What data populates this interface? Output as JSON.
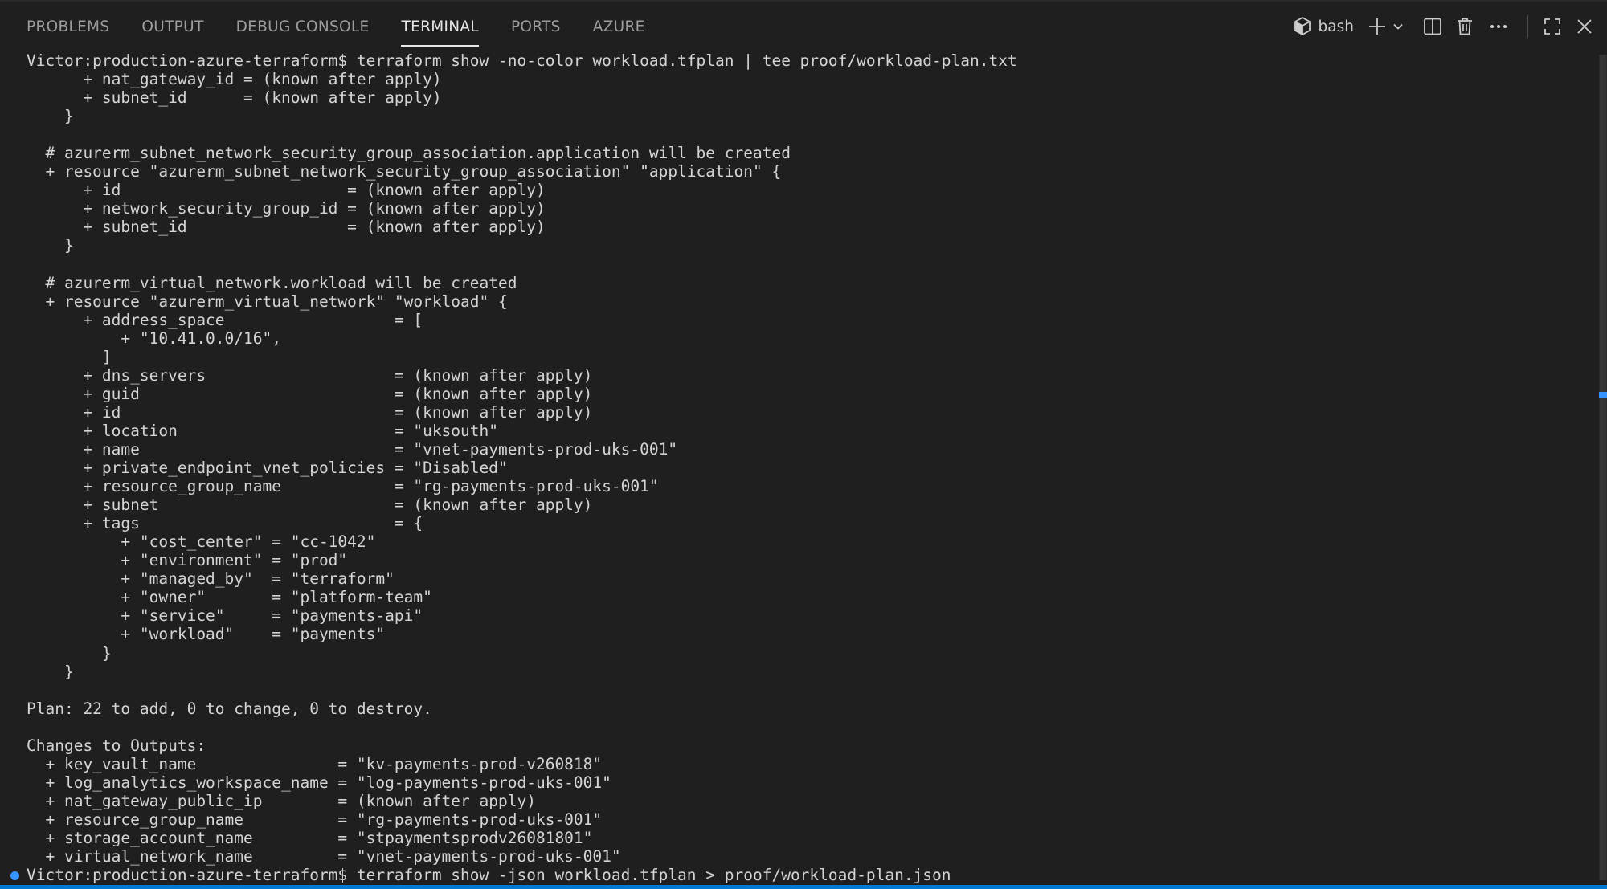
{
  "panel": {
    "tabs": [
      {
        "label": "PROBLEMS",
        "active": false
      },
      {
        "label": "OUTPUT",
        "active": false
      },
      {
        "label": "DEBUG CONSOLE",
        "active": false
      },
      {
        "label": "TERMINAL",
        "active": true
      },
      {
        "label": "PORTS",
        "active": false
      },
      {
        "label": "AZURE",
        "active": false
      }
    ],
    "toolbar": {
      "shell_icon": "terminal-cube-icon",
      "shell_name": "bash",
      "new_terminal_icon": "plus-icon",
      "dropdown_icon": "chevron-down-icon",
      "split_icon": "split-terminal-icon",
      "kill_icon": "trash-icon",
      "more_icon": "ellipsis-icon",
      "maximize_icon": "maximize-icon",
      "close_icon": "close-icon"
    }
  },
  "colors": {
    "background": "#1f1f1f",
    "text": "#d4d4d4",
    "accent": "#0078d4",
    "command_marker": "#3794ff"
  },
  "terminal": {
    "lines": [
      "Victor:production-azure-terraform$ terraform show -no-color workload.tfplan | tee proof/workload-plan.txt",
      "      + nat_gateway_id = (known after apply)",
      "      + subnet_id      = (known after apply)",
      "    }",
      "",
      "  # azurerm_subnet_network_security_group_association.application will be created",
      "  + resource \"azurerm_subnet_network_security_group_association\" \"application\" {",
      "      + id                        = (known after apply)",
      "      + network_security_group_id = (known after apply)",
      "      + subnet_id                 = (known after apply)",
      "    }",
      "",
      "  # azurerm_virtual_network.workload will be created",
      "  + resource \"azurerm_virtual_network\" \"workload\" {",
      "      + address_space                  = [",
      "          + \"10.41.0.0/16\",",
      "        ]",
      "      + dns_servers                    = (known after apply)",
      "      + guid                           = (known after apply)",
      "      + id                             = (known after apply)",
      "      + location                       = \"uksouth\"",
      "      + name                           = \"vnet-payments-prod-uks-001\"",
      "      + private_endpoint_vnet_policies = \"Disabled\"",
      "      + resource_group_name            = \"rg-payments-prod-uks-001\"",
      "      + subnet                         = (known after apply)",
      "      + tags                           = {",
      "          + \"cost_center\" = \"cc-1042\"",
      "          + \"environment\" = \"prod\"",
      "          + \"managed_by\"  = \"terraform\"",
      "          + \"owner\"       = \"platform-team\"",
      "          + \"service\"     = \"payments-api\"",
      "          + \"workload\"    = \"payments\"",
      "        }",
      "    }",
      "",
      "Plan: 22 to add, 0 to change, 0 to destroy.",
      "",
      "Changes to Outputs:",
      "  + key_vault_name               = \"kv-payments-prod-v260818\"",
      "  + log_analytics_workspace_name = \"log-payments-prod-uks-001\"",
      "  + nat_gateway_public_ip        = (known after apply)",
      "  + resource_group_name          = \"rg-payments-prod-uks-001\"",
      "  + storage_account_name         = \"stpaymentsprodv26081801\"",
      "  + virtual_network_name         = \"vnet-payments-prod-uks-001\"",
      "Victor:production-azure-terraform$ terraform show -json workload.tfplan > proof/workload-plan.json"
    ]
  }
}
